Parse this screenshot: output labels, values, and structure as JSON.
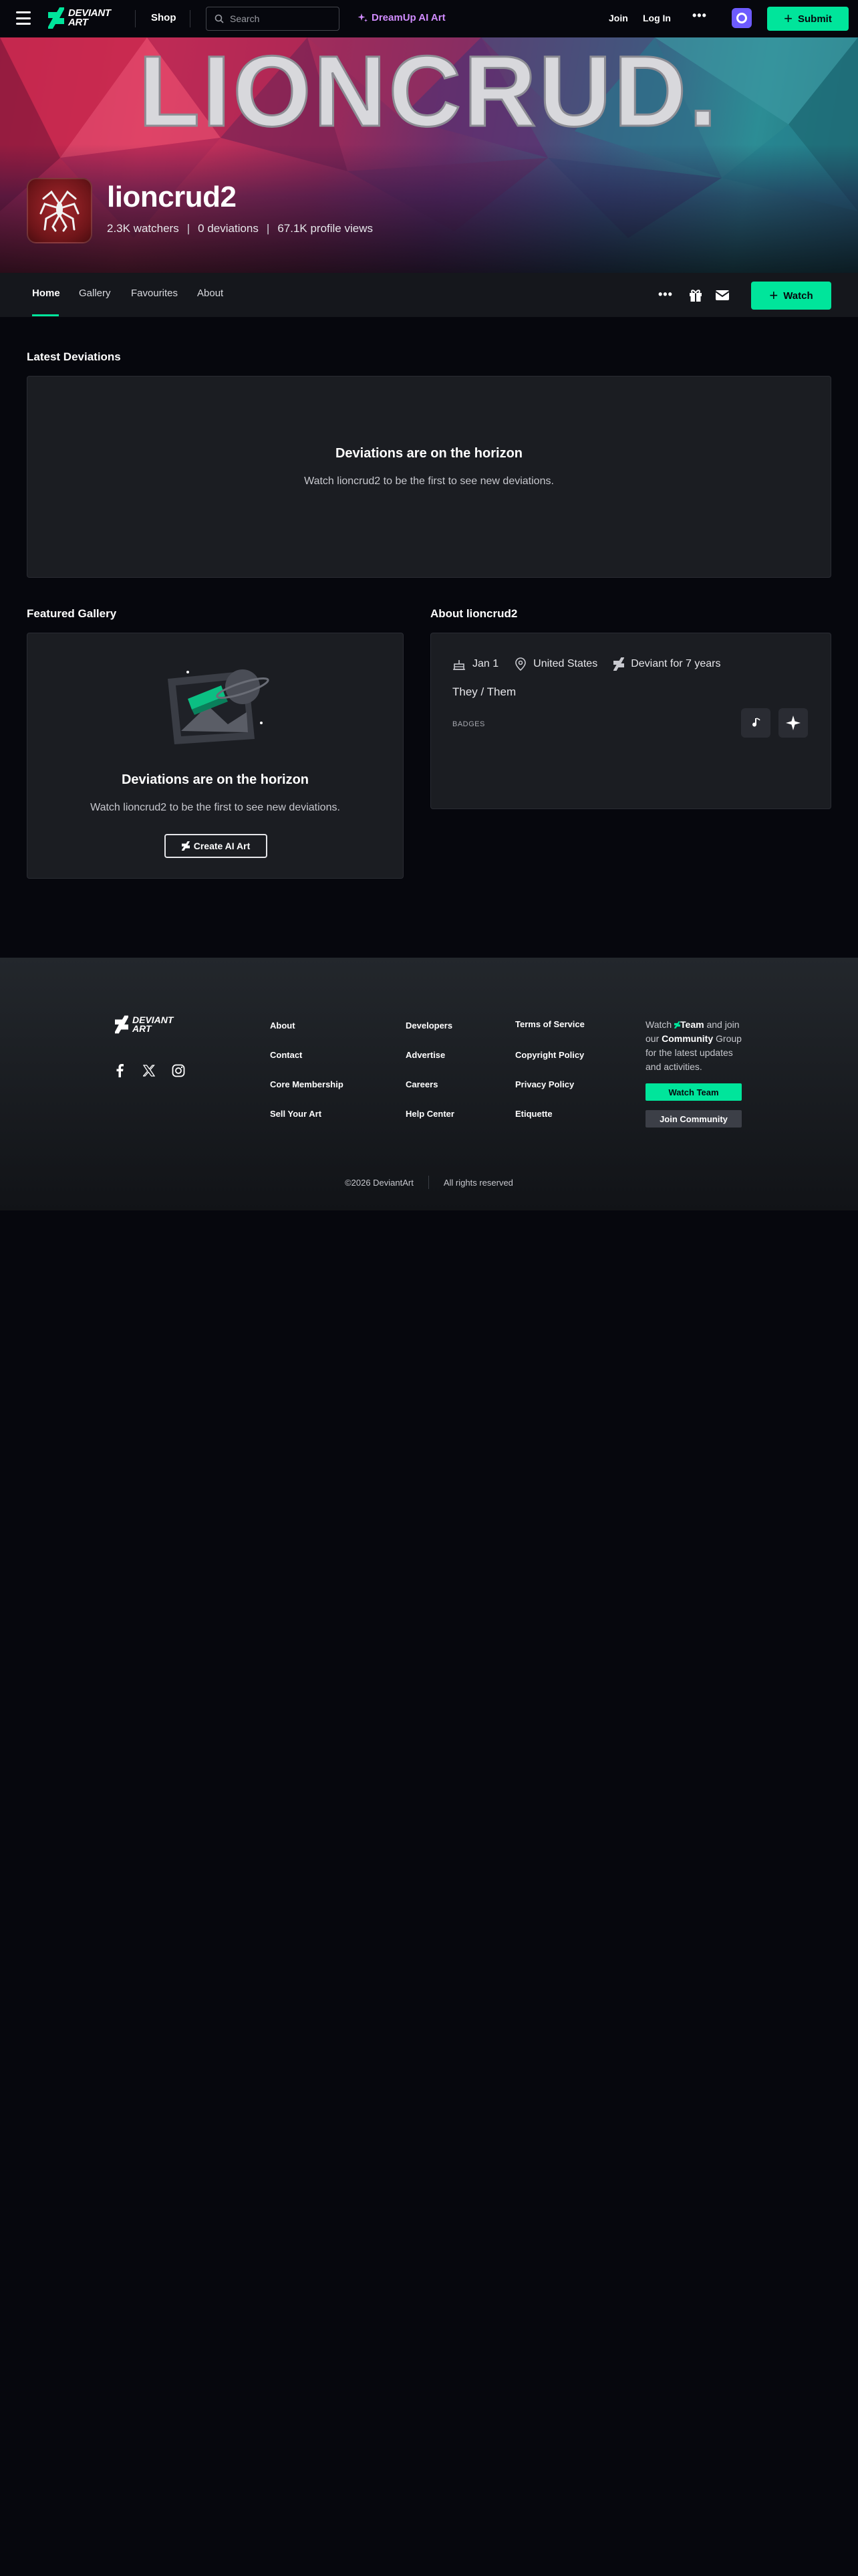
{
  "topbar": {
    "brand_line1": "DEVIANT",
    "brand_line2": "ART",
    "shop": "Shop",
    "search_placeholder": "Search",
    "dreamup": "DreamUp AI Art",
    "join": "Join",
    "login": "Log In",
    "more": "•••",
    "submit": "Submit"
  },
  "banner": {
    "artwork_text": "LIONCRUD."
  },
  "profile": {
    "username": "lioncrud2",
    "watchers": "2.3K watchers",
    "deviations": "0 deviations",
    "profile_views": "67.1K profile views",
    "sep": "|"
  },
  "nav": {
    "tabs": [
      "Home",
      "Gallery",
      "Favourites",
      "About"
    ],
    "more": "•••",
    "watch": "Watch"
  },
  "latest": {
    "title": "Latest Deviations",
    "empty_title": "Deviations are on the horizon",
    "empty_sub": "Watch lioncrud2 to be the first to see new deviations."
  },
  "featured": {
    "title": "Featured Gallery",
    "empty_title": "Deviations are on the horizon",
    "empty_sub": "Watch lioncrud2 to be the first to see new deviations.",
    "cta": "Create AI Art"
  },
  "about": {
    "title": "About lioncrud2",
    "birthday": "Jan 1",
    "location": "United States",
    "member_for": "Deviant for 7 years",
    "pronouns": "They / Them",
    "badges_label": "BADGES"
  },
  "footer": {
    "brand_line1": "DEVIANT",
    "brand_line2": "ART",
    "col1": [
      "About",
      "Contact",
      "Core Membership",
      "Sell Your Art"
    ],
    "col2": [
      "Developers",
      "Advertise",
      "Careers",
      "Help Center"
    ],
    "col3": [
      "Terms of Service",
      "Copyright Policy",
      "Privacy Policy",
      "Etiquette"
    ],
    "cta_watch": "Watch",
    "cta_team": "Team",
    "cta_and": "and",
    "cta_join_our": "join our",
    "cta_community": "Community",
    "cta_rest": "Group for the latest updates and activities.",
    "watch_team": "Watch Team",
    "join_community": "Join Community",
    "copyright": "©2026 DeviantArt",
    "rights": "All rights reserved"
  },
  "colors": {
    "accent": "#00e59b",
    "dreamup": "#d18cff",
    "background": "#06070d",
    "panel": "#1b1d22"
  }
}
